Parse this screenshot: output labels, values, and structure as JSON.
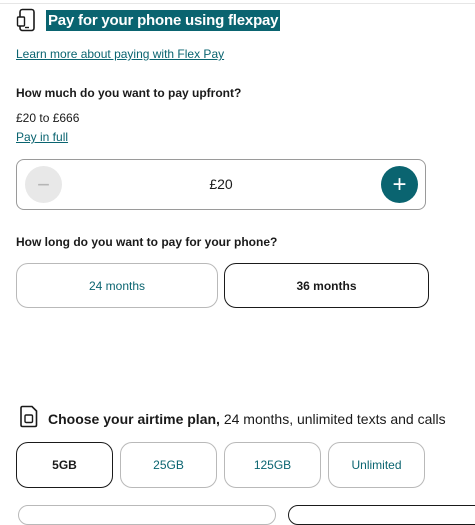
{
  "flexpay": {
    "title": "Pay for your phone using flexpay",
    "learn_more": "Learn more about paying with Flex Pay",
    "upfront_question": "How much do you want to pay upfront?",
    "range": "£20 to £666",
    "pay_in_full": "Pay in full",
    "stepper": {
      "value": "£20",
      "minus_symbol": "−",
      "plus_symbol": "+"
    },
    "duration_question": "How long do you want to pay for your phone?",
    "durations": [
      {
        "label": "24 months",
        "selected": false
      },
      {
        "label": "36 months",
        "selected": true
      }
    ]
  },
  "airtime": {
    "title": "Choose your airtime plan,",
    "subtitle": " 24 months, unlimited texts and calls",
    "data_options": [
      {
        "label": "5GB",
        "selected": true
      },
      {
        "label": "25GB",
        "selected": false
      },
      {
        "label": "125GB",
        "selected": false
      },
      {
        "label": "Unlimited",
        "selected": false
      }
    ]
  },
  "colors": {
    "accent": "#0a6470",
    "text": "#1a1a1a",
    "border": "#b9b9b9"
  },
  "icons": {
    "flexpay": "phone-icon",
    "airtime": "sim-card-icon"
  }
}
